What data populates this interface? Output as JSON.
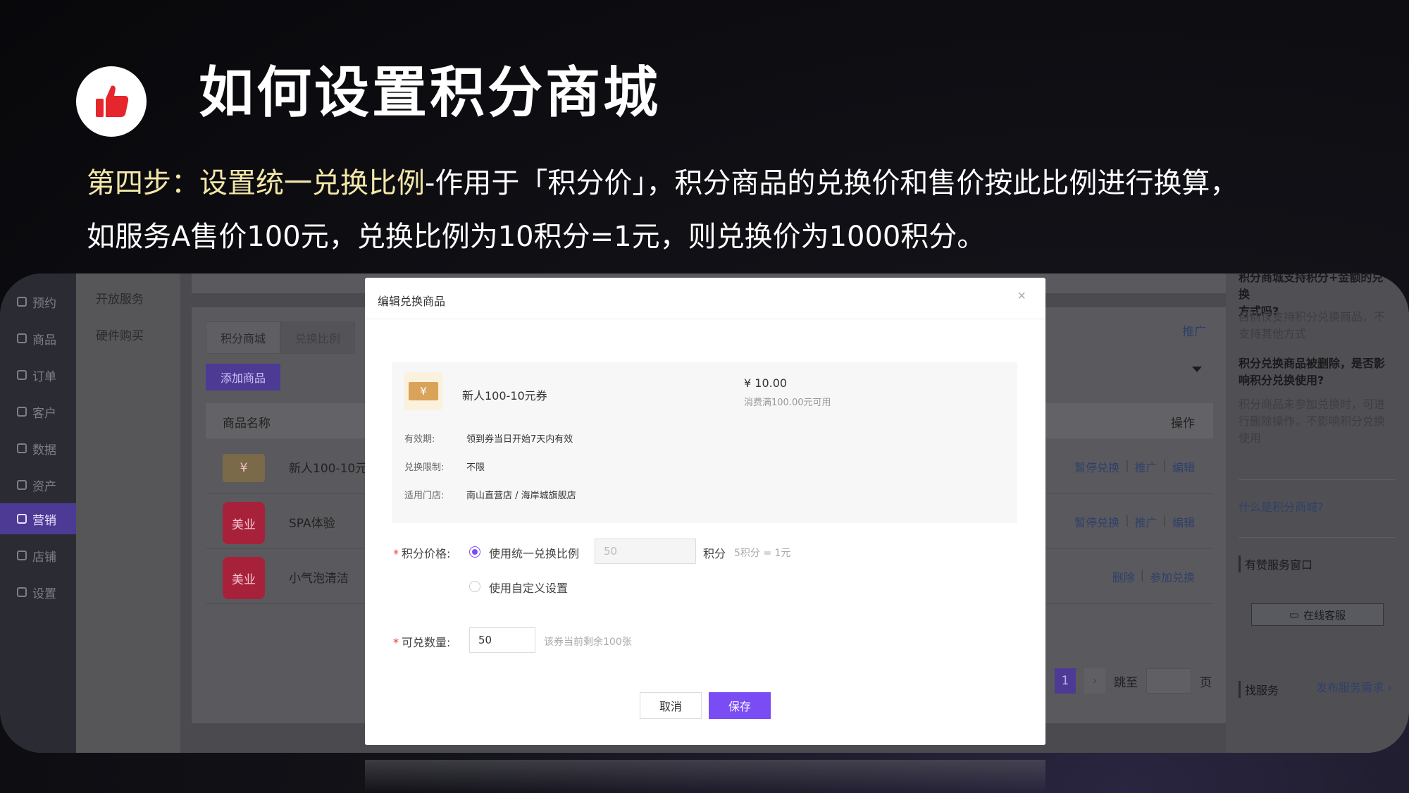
{
  "slide": {
    "heading": "如何设置积分商城",
    "desc_highlight": "第四步：设置统一兑换比例",
    "desc_line1": "-作用于「积分价」，积分商品的兑换价和售价按此比例进行换算，",
    "desc_line2": "如服务A售价100元，兑换比例为10积分=1元，则兑换价为1000积分。",
    "logo_icon": "thumbs-up-icon",
    "accent_color": "#e5262c"
  },
  "nav": {
    "items": [
      {
        "label": "预约",
        "icon": "calendar-icon"
      },
      {
        "label": "商品",
        "icon": "bag-icon"
      },
      {
        "label": "订单",
        "icon": "list-icon"
      },
      {
        "label": "客户",
        "icon": "user-icon"
      },
      {
        "label": "数据",
        "icon": "chart-icon"
      },
      {
        "label": "资产",
        "icon": "coin-icon"
      },
      {
        "label": "营销",
        "icon": "grid-icon"
      },
      {
        "label": "店铺",
        "icon": "store-icon"
      },
      {
        "label": "设置",
        "icon": "gear-icon"
      }
    ],
    "active": "营销"
  },
  "subnav": {
    "items": [
      "开放服务",
      "硬件购买"
    ]
  },
  "main": {
    "tabs": [
      "积分商城",
      "兑换比例"
    ],
    "add_button": "添加商品",
    "promo_link": "推广",
    "columns": {
      "name": "商品名称",
      "ops": "操作"
    },
    "rows": [
      {
        "thumb": "¥",
        "name": "新人100-10元券",
        "ops": [
          "暂停兑换",
          "推广",
          "编辑"
        ]
      },
      {
        "thumb": "美业",
        "name": "SPA体验",
        "ops": [
          "暂停兑换",
          "推广",
          "编辑"
        ]
      },
      {
        "thumb": "美业",
        "name": "小气泡清洁",
        "ops": [
          "删除",
          "参加兑换"
        ]
      }
    ],
    "pager": {
      "current": "1",
      "next": "›",
      "jump_label": "跳至",
      "page_suffix": "页"
    }
  },
  "aside": {
    "q1_title_a": "积分商城支持积分+金额的兑换",
    "q1_title_b": "方式吗?",
    "q1_answer": "目前仅支持积分兑换商品，不支持其他方式",
    "q2_title": "积分兑换商品被删除，是否影响积分兑换使用?",
    "q2_answer": "积分商品未参加兑换时，可进行删除操作，不影响积分兑换使用",
    "what_link": "什么是积分商城?",
    "service_section": "有赞服务窗口",
    "cs_button": "在线客服",
    "find_section": "找服务",
    "publish_link": "发布服务需求 ›"
  },
  "modal": {
    "title": "编辑兑换商品",
    "close": "×",
    "coupon_tag": "¥",
    "item_name": "新人100-10元券",
    "price": "¥ 10.00",
    "price_note": "消费满100.00元可用",
    "info": [
      {
        "label": "有效期:",
        "value": "领到券当日开始7天内有效"
      },
      {
        "label": "兑换限制:",
        "value": "不限"
      },
      {
        "label": "适用门店:",
        "value": "南山直营店 / 海岸城旗舰店"
      }
    ],
    "points_label": "积分价格:",
    "option_unified": "使用统一兑换比例",
    "unified_value": "50",
    "points_unit": "积分",
    "ratio_hint": "5积分 = 1元",
    "option_custom": "使用自定义设置",
    "qty_label": "可兑数量:",
    "qty_value": "50",
    "qty_hint": "该券当前剩余100张",
    "cancel": "取消",
    "save": "保存",
    "primary_color": "#7a4cf4"
  }
}
